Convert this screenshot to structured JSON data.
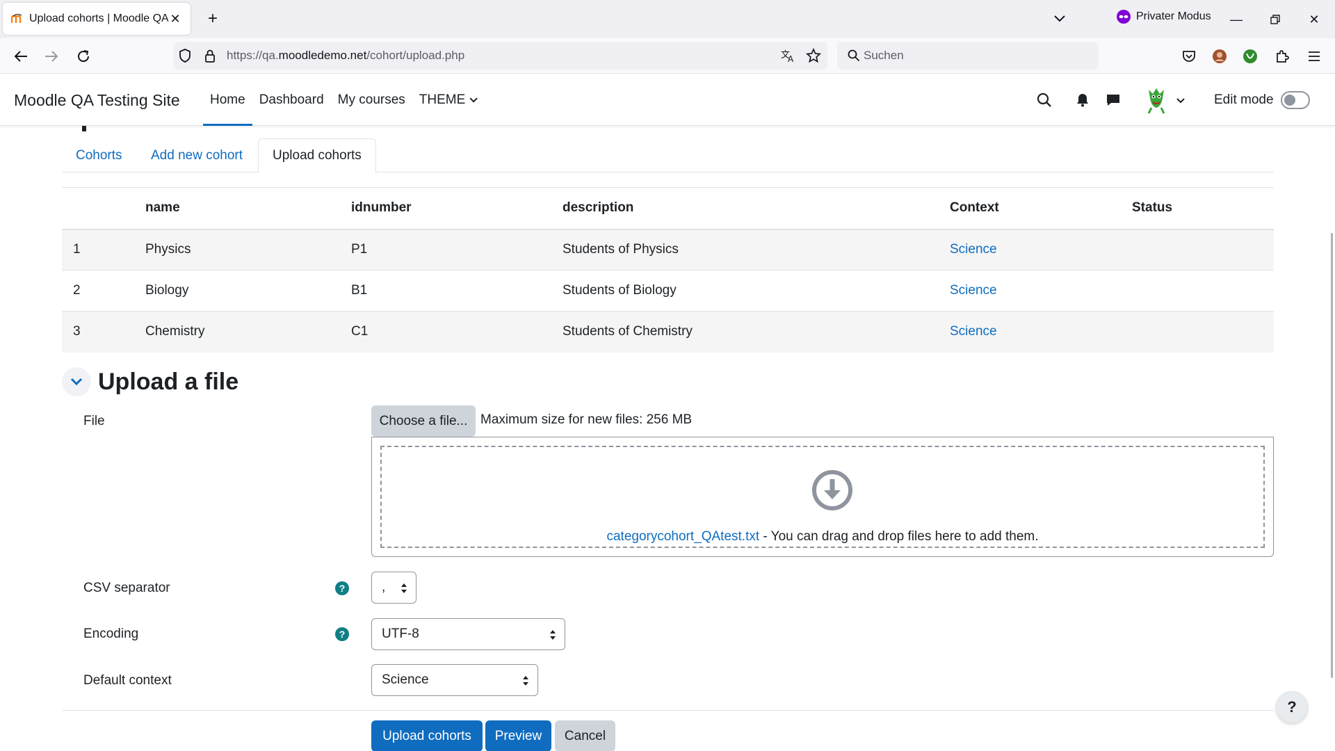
{
  "browser": {
    "tab_title": "Upload cohorts | Moodle QA Te",
    "private_label": "Privater Modus",
    "url_prefix": "https://qa.",
    "url_host": "moodledemo.net",
    "url_path": "/cohort/upload.php",
    "search_placeholder": "Suchen"
  },
  "header": {
    "brand": "Moodle QA Testing Site",
    "nav": [
      "Home",
      "Dashboard",
      "My courses",
      "THEME"
    ],
    "edit_mode_label": "Edit mode"
  },
  "tabs": [
    "Cohorts",
    "Add new cohort",
    "Upload cohorts"
  ],
  "preview_table": {
    "headers": [
      "",
      "name",
      "idnumber",
      "description",
      "Context",
      "Status"
    ],
    "rows": [
      [
        "1",
        "Physics",
        "P1",
        "Students of Physics",
        "Science",
        ""
      ],
      [
        "2",
        "Biology",
        "B1",
        "Students of Biology",
        "Science",
        ""
      ],
      [
        "3",
        "Chemistry",
        "C1",
        "Students of Chemistry",
        "Science",
        ""
      ]
    ]
  },
  "upload": {
    "section_title": "Upload a file",
    "file_label": "File",
    "choose_button": "Choose a file...",
    "max_size": "Maximum size for new files: 256 MB",
    "file_name": "categorycohort_QAtest.txt",
    "drop_hint": " - You can drag and drop files here to add them.",
    "csv_label": "CSV separator",
    "csv_value": ",",
    "encoding_label": "Encoding",
    "encoding_value": "UTF-8",
    "context_label": "Default context",
    "context_value": "Science"
  },
  "buttons": {
    "upload": "Upload cohorts",
    "preview": "Preview",
    "cancel": "Cancel",
    "help": "?"
  },
  "colors": {
    "primary": "#0f6cbf",
    "help_icon": "#0f7f85"
  }
}
